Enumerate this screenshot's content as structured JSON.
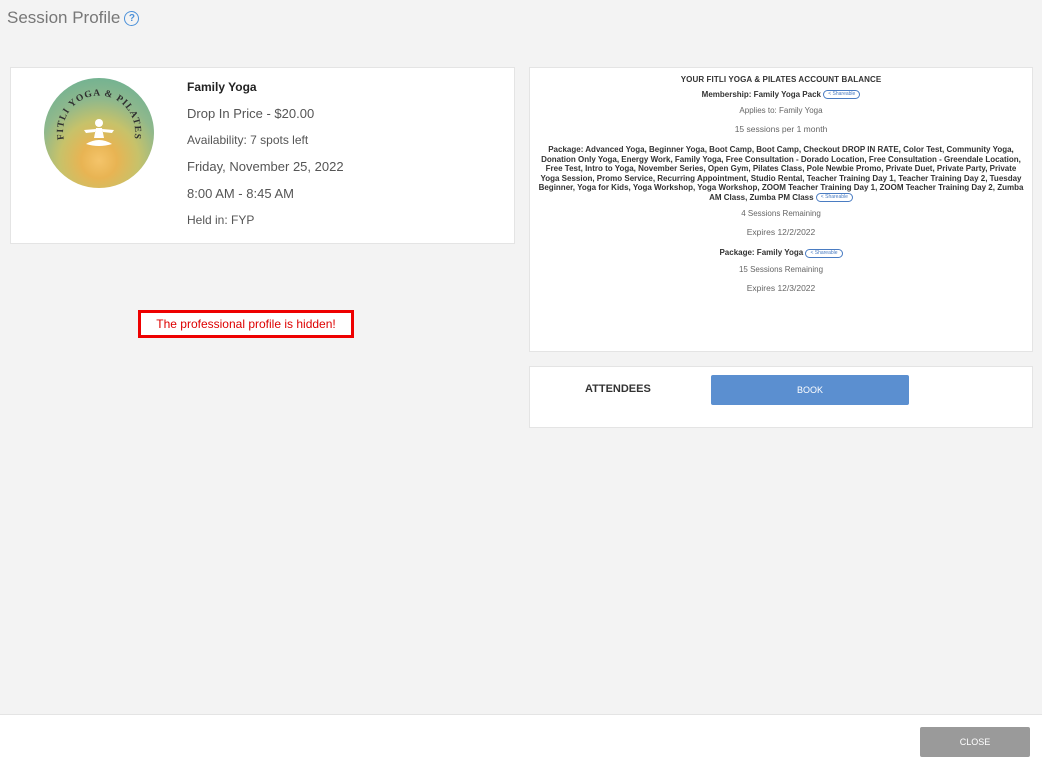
{
  "header": {
    "title": "Session Profile",
    "help_icon": "help-circle-icon"
  },
  "session": {
    "logo_text": "FITLI YOGA & PILATES",
    "name": "Family Yoga",
    "drop_in_price": "Drop In Price - $20.00",
    "availability": "Availability: 7 spots left",
    "date": "Friday, November 25, 2022",
    "time": "8:00 AM - 8:45 AM",
    "held_in": "Held in: FYP"
  },
  "hidden_message": "The professional profile is hidden!",
  "balance": {
    "title": "YOUR FITLI YOGA & PILATES ACCOUNT BALANCE",
    "membership": "Membership: Family Yoga Pack",
    "shareable_label": "Shareable",
    "applies_to": "Applies to: Family Yoga",
    "sessions_per": "15 sessions per 1 month",
    "package1": "Package: Advanced Yoga, Beginner Yoga, Boot Camp, Boot Camp, Checkout DROP IN RATE, Color Test, Community Yoga, Donation Only Yoga, Energy Work, Family Yoga, Free Consultation - Dorado Location, Free Consultation - Greendale Location, Free Test, Intro to Yoga, November Series, Open Gym, Pilates Class, Pole Newbie Promo, Private Duet, Private Party, Private Yoga Session, Promo Service, Recurring Appointment, Studio Rental, Teacher Training Day 1, Teacher Training Day 2, Tuesday Beginner, Yoga for Kids, Yoga Workshop, Yoga Workshop, ZOOM Teacher Training Day 1, ZOOM Teacher Training Day 2, Zumba AM Class, Zumba PM Class",
    "package1_remaining": "4 Sessions Remaining",
    "package1_expires": "Expires 12/2/2022",
    "package2": "Package: Family Yoga",
    "package2_remaining": "15 Sessions Remaining",
    "package2_expires": "Expires 12/3/2022"
  },
  "attendees": {
    "label": "ATTENDEES",
    "book_label": "BOOK"
  },
  "footer": {
    "close_label": "CLOSE"
  }
}
